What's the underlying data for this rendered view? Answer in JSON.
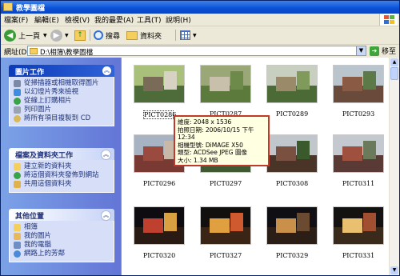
{
  "window": {
    "title": "教學圖檔"
  },
  "menu": [
    "檔案(F)",
    "編輯(E)",
    "檢視(V)",
    "我的最愛(A)",
    "工具(T)",
    "說明(H)"
  ],
  "toolbar": {
    "back": "上一頁",
    "search": "搜尋",
    "folders": "資料夾"
  },
  "address": {
    "label": "網址(D)",
    "path": "D:\\相簿\\教學圖檔",
    "go": "移至"
  },
  "tasks": {
    "picture": {
      "title": "圖片工作",
      "items": [
        "從掃描器或相機取得圖片",
        "以幻燈片秀來檢視",
        "從線上訂購相片",
        "列印圖片",
        "將所有項目複製到 CD"
      ]
    },
    "file": {
      "title": "檔案及資料夾工作",
      "items": [
        "建立新的資料夾",
        "將這個資料夾發佈到網站",
        "共用這個資料夾"
      ]
    },
    "places": {
      "title": "其他位置",
      "items": [
        "相簿",
        "我的圖片",
        "我的電腦",
        "網路上的芳鄰"
      ]
    }
  },
  "thumbnails": [
    "PICT0286",
    "PICT0287",
    "PICT0289",
    "PICT0293",
    "PICT0296",
    "PICT0297",
    "PICT0308",
    "PICT0311",
    "PICT0320",
    "PICT0327",
    "PICT0329",
    "PICT0331"
  ],
  "tooltip": {
    "line1": "維度: 2048 x 1536",
    "line2": "拍照日期: 2006/10/15 下午 12:34",
    "line3": "相機型號: DiMAGE X50",
    "line4": "類型: ACDSee JPEG 圖像",
    "line5": "大小: 1.34 MB"
  },
  "colors": {
    "titlebar": "#0a4fd6",
    "panel_bg": "#d6dff7",
    "tooltip_border": "#c0392b"
  }
}
